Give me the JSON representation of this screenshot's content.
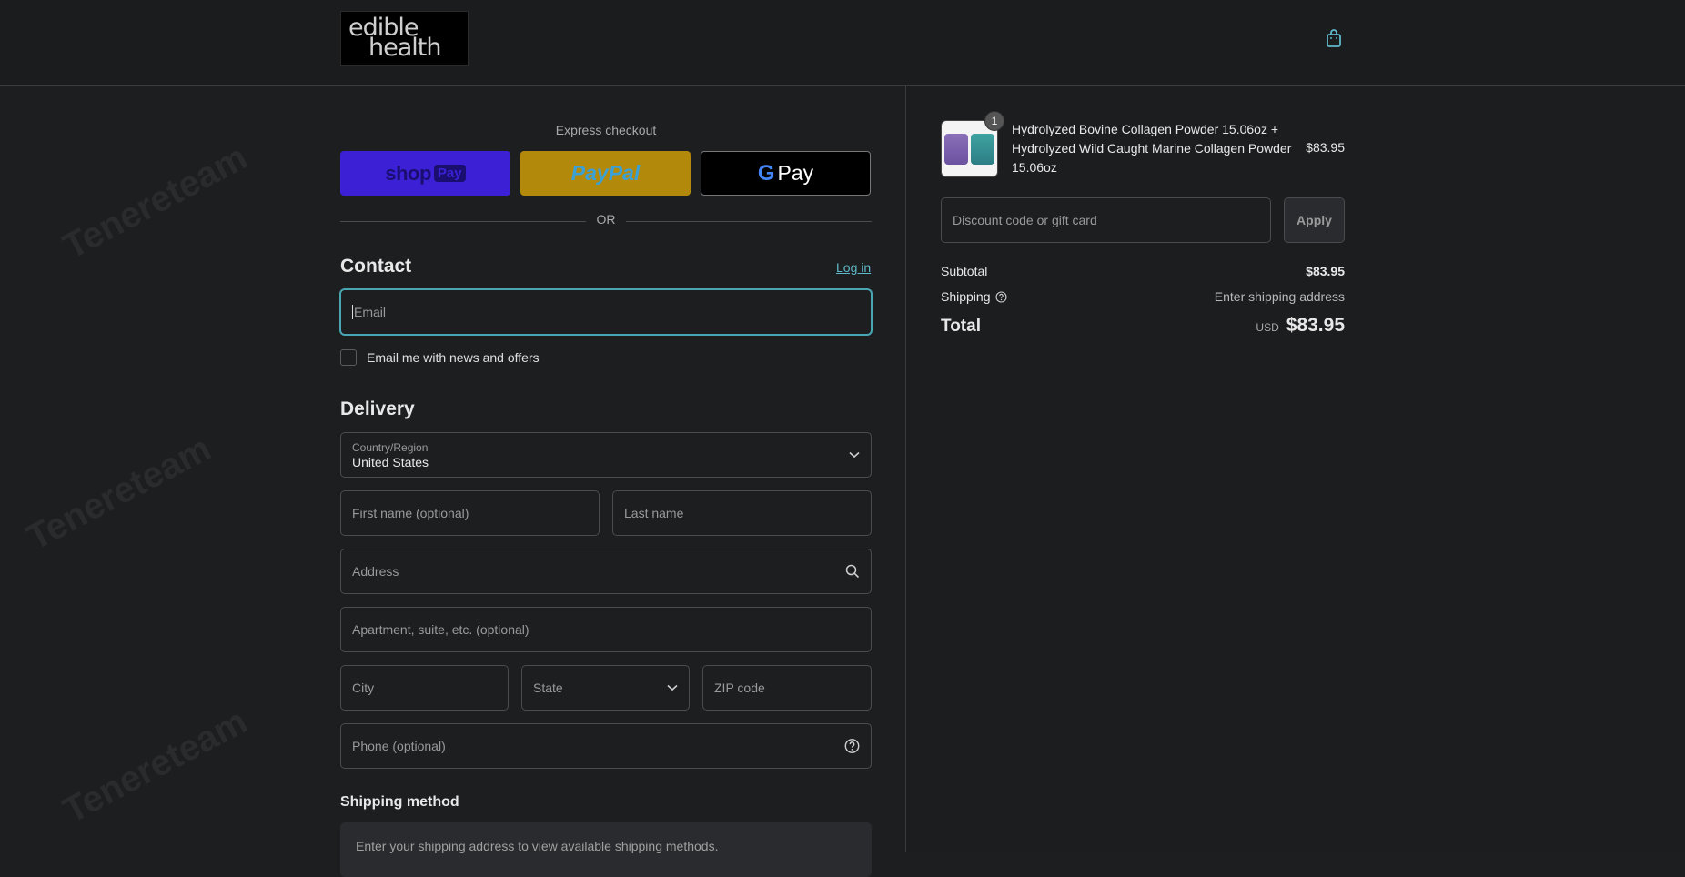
{
  "header": {
    "logo_line1": "edible",
    "logo_line2": "health",
    "cart_icon": "shopping-bag-icon"
  },
  "express": {
    "label": "Express checkout",
    "shop_label": "shop",
    "shop_pay_label": "Pay",
    "paypal_label": "PayPal",
    "gpay_g": "G",
    "gpay_label": "Pay",
    "or_label": "OR"
  },
  "contact": {
    "title": "Contact",
    "login_label": "Log in",
    "email_placeholder": "Email",
    "newsletter_label": "Email me with news and offers"
  },
  "delivery": {
    "title": "Delivery",
    "country_label": "Country/Region",
    "country_value": "United States",
    "first_name_placeholder": "First name (optional)",
    "last_name_placeholder": "Last name",
    "address_placeholder": "Address",
    "apartment_placeholder": "Apartment, suite, etc. (optional)",
    "city_placeholder": "City",
    "state_placeholder": "State",
    "zip_placeholder": "ZIP code",
    "phone_placeholder": "Phone (optional)"
  },
  "shipping_method": {
    "title": "Shipping method",
    "message": "Enter your shipping address to view available shipping methods."
  },
  "order": {
    "product_name": "Hydrolyzed Bovine Collagen Powder 15.06oz + Hydrolyzed Wild Caught Marine Collagen Powder 15.06oz",
    "product_qty": "1",
    "product_price": "$83.95",
    "discount_placeholder": "Discount code or gift card",
    "apply_label": "Apply",
    "subtotal_label": "Subtotal",
    "subtotal_value": "$83.95",
    "shipping_label": "Shipping",
    "shipping_value": "Enter shipping address",
    "total_label": "Total",
    "total_currency": "USD",
    "total_value": "$83.95"
  },
  "watermark": "Tenereteam",
  "colors": {
    "background": "#1d1e20",
    "accent": "#5fb8c9",
    "shop_pay": "#3b20d6",
    "paypal": "#b3890c"
  }
}
